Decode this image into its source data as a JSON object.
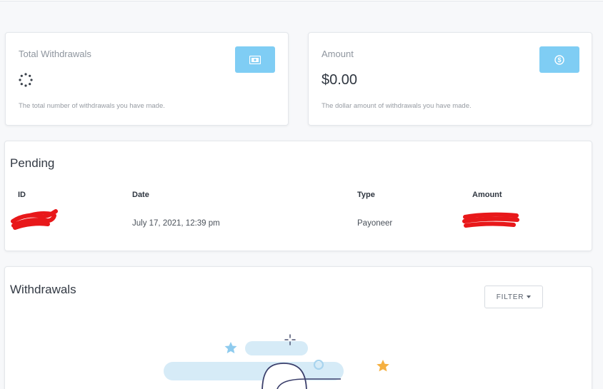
{
  "stats": {
    "withdrawals": {
      "title": "Total Withdrawals",
      "description": "The total number of withdrawals you have made.",
      "icon": "money-bill-icon",
      "loading": true
    },
    "amount": {
      "title": "Amount",
      "value": "$0.00",
      "description": "The dollar amount of withdrawals you have made.",
      "icon": "dollar-coin-icon"
    }
  },
  "pending": {
    "title": "Pending",
    "columns": [
      "ID",
      "Date",
      "Type",
      "Amount"
    ],
    "rows": [
      {
        "id": "",
        "date": "July 17, 2021, 12:39 pm",
        "type": "Payoneer",
        "amount": ""
      }
    ]
  },
  "withdrawals": {
    "title": "Withdrawals",
    "filter_label": "FILTER"
  },
  "colors": {
    "accent": "#7fcdf4",
    "redaction": "#e8181a",
    "illustration_blue": "#d6ebf7",
    "star_orange": "#f5b041",
    "star_blue": "#8ecbee"
  }
}
